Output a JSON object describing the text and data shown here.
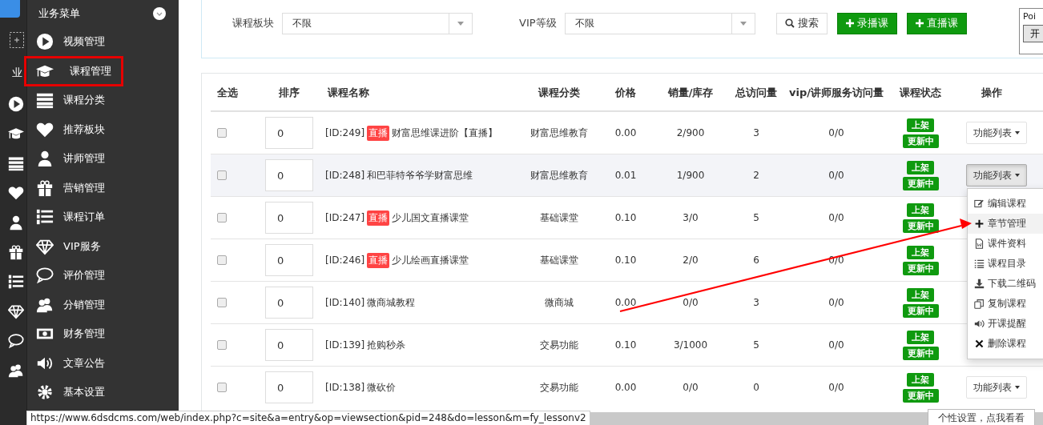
{
  "rail": {
    "label": "业"
  },
  "sidebar": {
    "title": "业务菜单",
    "items": [
      {
        "label": "视频管理",
        "annotated": false
      },
      {
        "label": "课程管理",
        "annotated": true
      },
      {
        "label": "课程分类",
        "annotated": false
      },
      {
        "label": "推荐板块",
        "annotated": false
      },
      {
        "label": "讲师管理",
        "annotated": false
      },
      {
        "label": "营销管理",
        "annotated": false
      },
      {
        "label": "课程订单",
        "annotated": false
      },
      {
        "label": "VIP服务",
        "annotated": false
      },
      {
        "label": "评价管理",
        "annotated": false
      },
      {
        "label": "分销管理",
        "annotated": false
      },
      {
        "label": "财务管理",
        "annotated": false
      },
      {
        "label": "文章公告",
        "annotated": false
      },
      {
        "label": "基本设置",
        "annotated": false
      }
    ]
  },
  "filters": [
    {
      "label": "课程板块",
      "value": "不限"
    },
    {
      "label": "VIP等级",
      "value": "不限"
    }
  ],
  "actions": [
    {
      "kind": "search",
      "label": "搜索"
    },
    {
      "kind": "add",
      "label": "录播课"
    },
    {
      "kind": "add",
      "label": "直播课"
    }
  ],
  "corner_panel": {
    "title": "Poi",
    "button": "开"
  },
  "table": {
    "columns": [
      "全选",
      "排序",
      "课程名称",
      "课程分类",
      "价格",
      "销量/库存",
      "总访问量",
      "vip/讲师服务访问量",
      "课程状态",
      "操作"
    ],
    "rows": [
      {
        "checked": false,
        "selected": false,
        "sort": "0",
        "id": "[ID:249]",
        "tag": "直播",
        "title": "财富思维课进阶【直播】",
        "category": "财富思维教育",
        "price": "0.00",
        "sales": "2/900",
        "visits": "3",
        "vip_visits": "0/0",
        "status": [
          "上架",
          "更新中"
        ],
        "action": "功能列表",
        "menu_open": false
      },
      {
        "checked": false,
        "selected": true,
        "sort": "0",
        "id": "[ID:248]",
        "title": "和巴菲特爷爷学财富思维",
        "category": "财富思维教育",
        "price": "0.01",
        "sales": "1/900",
        "visits": "2",
        "vip_visits": "0/0",
        "status": [
          "上架",
          "更新中"
        ],
        "action": "功能列表",
        "menu_open": true
      },
      {
        "checked": false,
        "selected": false,
        "sort": "0",
        "id": "[ID:247]",
        "tag": "直播",
        "title": "少儿国文直播课堂",
        "category": "基础课堂",
        "price": "0.10",
        "sales": "3/0",
        "visits": "5",
        "vip_visits": "0/0",
        "status": [
          "上架",
          "更新中"
        ],
        "menu_open": false
      },
      {
        "checked": false,
        "selected": false,
        "sort": "0",
        "id": "[ID:246]",
        "tag": "直播",
        "title": "少儿绘画直播课堂",
        "category": "基础课堂",
        "price": "0.10",
        "sales": "2/0",
        "visits": "6",
        "vip_visits": "0/0",
        "status": [
          "上架",
          "更新中"
        ],
        "menu_open": false
      },
      {
        "checked": false,
        "selected": false,
        "sort": "0",
        "id": "[ID:140]",
        "title": "微商城教程",
        "category": "微商城",
        "price": "0.00",
        "sales": "0/0",
        "visits": "3",
        "vip_visits": "0/0",
        "status": [
          "上架",
          "更新中"
        ],
        "menu_open": false
      },
      {
        "checked": false,
        "selected": false,
        "sort": "0",
        "id": "[ID:139]",
        "title": "抢购秒杀",
        "category": "交易功能",
        "price": "0.10",
        "sales": "3/1000",
        "visits": "5",
        "vip_visits": "0/0",
        "status": [
          "上架",
          "更新中"
        ],
        "menu_open": false
      },
      {
        "checked": false,
        "selected": false,
        "sort": "0",
        "id": "[ID:138]",
        "title": "微砍价",
        "category": "交易功能",
        "price": "0.00",
        "sales": "0/0",
        "visits": "0",
        "vip_visits": "0/0",
        "status": [
          "上架",
          "更新中"
        ],
        "action": "功能列表",
        "menu_open": false
      }
    ]
  },
  "dropdown_menu": {
    "items": [
      {
        "label": "编辑课程",
        "highlighted": false
      },
      {
        "label": "章节管理",
        "highlighted": true
      },
      {
        "label": "课件资料",
        "highlighted": false
      },
      {
        "label": "课程目录",
        "highlighted": false
      },
      {
        "label": "下载二维码",
        "highlighted": false
      },
      {
        "label": "复制课程",
        "highlighted": false
      },
      {
        "label": "开课提醒",
        "highlighted": false
      },
      {
        "label": "删除课程",
        "highlighted": false
      }
    ]
  },
  "status_url": "https://www.6dsdcms.com/web/index.php?c=site&a=entry&op=viewsection&pid=248&do=lesson&m=fy_lessonv2",
  "tooltip": "个性设置，点我看看"
}
